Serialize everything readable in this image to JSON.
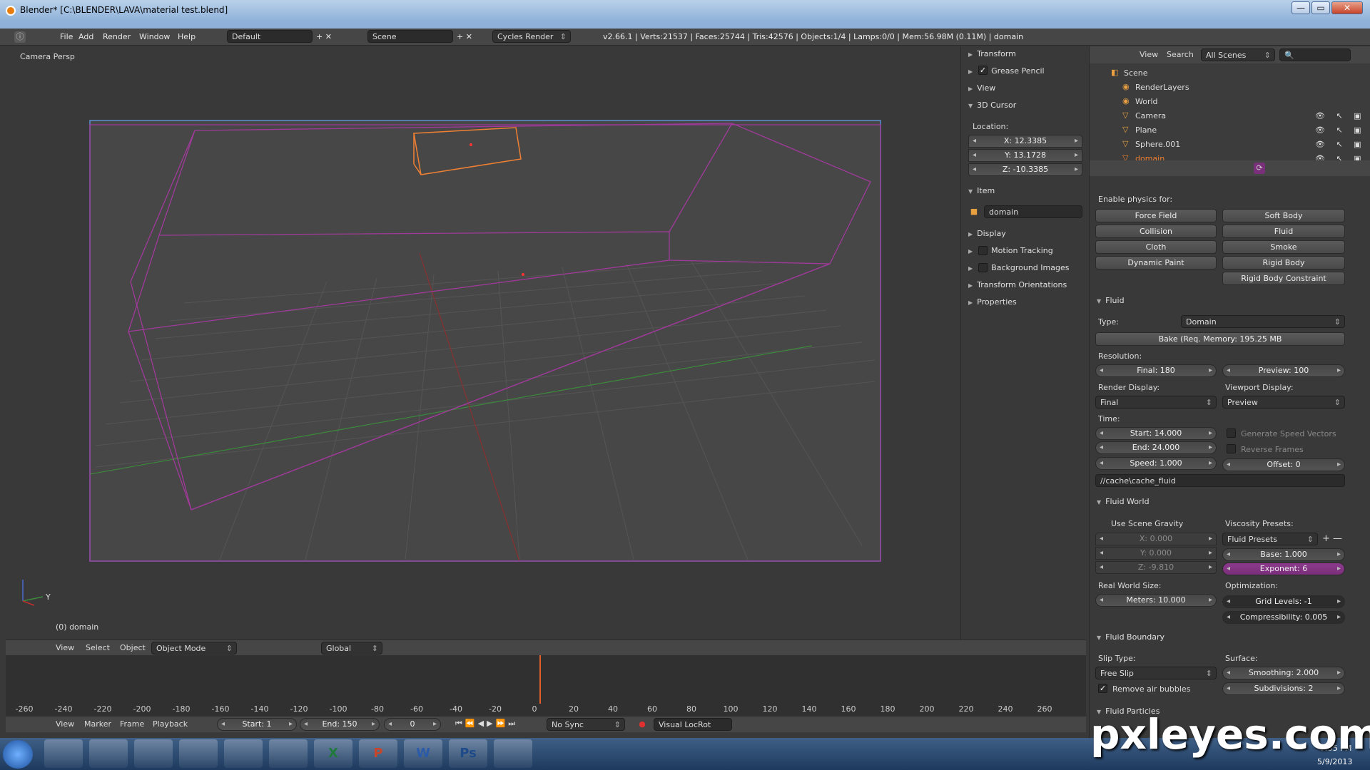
{
  "window": {
    "title": "Blender* [C:\\BLENDER\\LAVA\\material test.blend]",
    "min": "—",
    "max": "▭",
    "close": "✕"
  },
  "menu": {
    "file": "File",
    "add": "Add",
    "render": "Render",
    "window": "Window",
    "help": "Help",
    "layout": "Default",
    "scene": "Scene",
    "engine": "Cycles Render",
    "stats": "v2.66.1 | Verts:21537 | Faces:25744 | Tris:42576 | Objects:1/4 | Lamps:0/0 | Mem:56.98M (0.11M) | domain"
  },
  "viewport": {
    "label": "Camera Persp",
    "object": "(0) domain",
    "axis_y": "Y"
  },
  "npanel": {
    "transform": "Transform",
    "grease": "Grease Pencil",
    "view": "View",
    "cursor": "3D Cursor",
    "location": "Location:",
    "x": "X: 12.3385",
    "y": "Y: 13.1728",
    "z": "Z: -10.3385",
    "item": "Item",
    "item_name": "domain",
    "display": "Display",
    "motion": "Motion Tracking",
    "bgimg": "Background Images",
    "orient": "Transform Orientations",
    "props": "Properties"
  },
  "outliner": {
    "view": "View",
    "search": "Search",
    "scenes": "All Scenes",
    "items": [
      {
        "label": "Scene"
      },
      {
        "label": "RenderLayers"
      },
      {
        "label": "World"
      },
      {
        "label": "Camera"
      },
      {
        "label": "Plane"
      },
      {
        "label": "Sphere.001"
      },
      {
        "label": "domain"
      }
    ]
  },
  "physics": {
    "enable": "Enable physics for:",
    "buttons": [
      "Force Field",
      "Soft Body",
      "Collision",
      "Fluid",
      "Cloth",
      "Smoke",
      "Dynamic Paint",
      "Rigid Body",
      "Rigid Body Constraint"
    ],
    "fluid_hdr": "Fluid",
    "type_lbl": "Type:",
    "type": "Domain",
    "bake": "Bake (Req. Memory: 195.25 MB",
    "res_lbl": "Resolution:",
    "final": "Final: 180",
    "preview": "Preview: 100",
    "rdisp_lbl": "Render Display:",
    "vdisp_lbl": "Viewport Display:",
    "rdisp": "Final",
    "vdisp": "Preview",
    "time_lbl": "Time:",
    "start": "Start: 14.000",
    "end": "End: 24.000",
    "speed": "Speed: 1.000",
    "offset": "Offset: 0",
    "gen_speed": "Generate Speed Vectors",
    "rev_frames": "Reverse Frames",
    "cache": "//cache\\cache_fluid",
    "world_hdr": "Fluid World",
    "gravity": "Use Scene Gravity",
    "visc_lbl": "Viscosity Presets:",
    "presets": "Fluid Presets",
    "gx": "X: 0.000",
    "gy": "Y: 0.000",
    "gz": "Z: -9.810",
    "base": "Base: 1.000",
    "exp": "Exponent: 6",
    "rws_lbl": "Real World Size:",
    "opt_lbl": "Optimization:",
    "meters": "Meters: 10.000",
    "grid": "Grid Levels: -1",
    "compress": "Compressibility: 0.005",
    "boundary_hdr": "Fluid Boundary",
    "slip_lbl": "Slip Type:",
    "surface_lbl": "Surface:",
    "slip": "Free Slip",
    "smoothing": "Smoothing: 2.000",
    "air": "Remove air bubbles",
    "subdiv": "Subdivisions: 2",
    "particles_hdr": "Fluid Particles"
  },
  "header3d": {
    "view": "View",
    "select": "Select",
    "object": "Object",
    "mode": "Object Mode",
    "orient": "Global"
  },
  "timeline": {
    "ticks": [
      "-260",
      "-240",
      "-220",
      "-200",
      "-180",
      "-160",
      "-140",
      "-120",
      "-100",
      "-80",
      "-60",
      "-40",
      "-20",
      "0",
      "20",
      "40",
      "60",
      "80",
      "100",
      "120",
      "140",
      "160",
      "180",
      "200",
      "220",
      "240",
      "260"
    ],
    "view": "View",
    "marker": "Marker",
    "frame": "Frame",
    "playback": "Playback",
    "start": "Start: 1",
    "end": "End: 150",
    "current": "0",
    "sync": "No Sync",
    "keying": "Visual LocRot"
  },
  "taskbar": {
    "time": "7:55 PM",
    "date": "5/9/2013",
    "apps": [
      "",
      "",
      "",
      "",
      "",
      "",
      "",
      "X",
      "P",
      "W",
      "Ps",
      ""
    ]
  },
  "watermark": "pxleyes.com",
  "colors": {
    "accent": "#7a2f7a",
    "selected": "#f08033",
    "wire": "#a03a9a"
  }
}
